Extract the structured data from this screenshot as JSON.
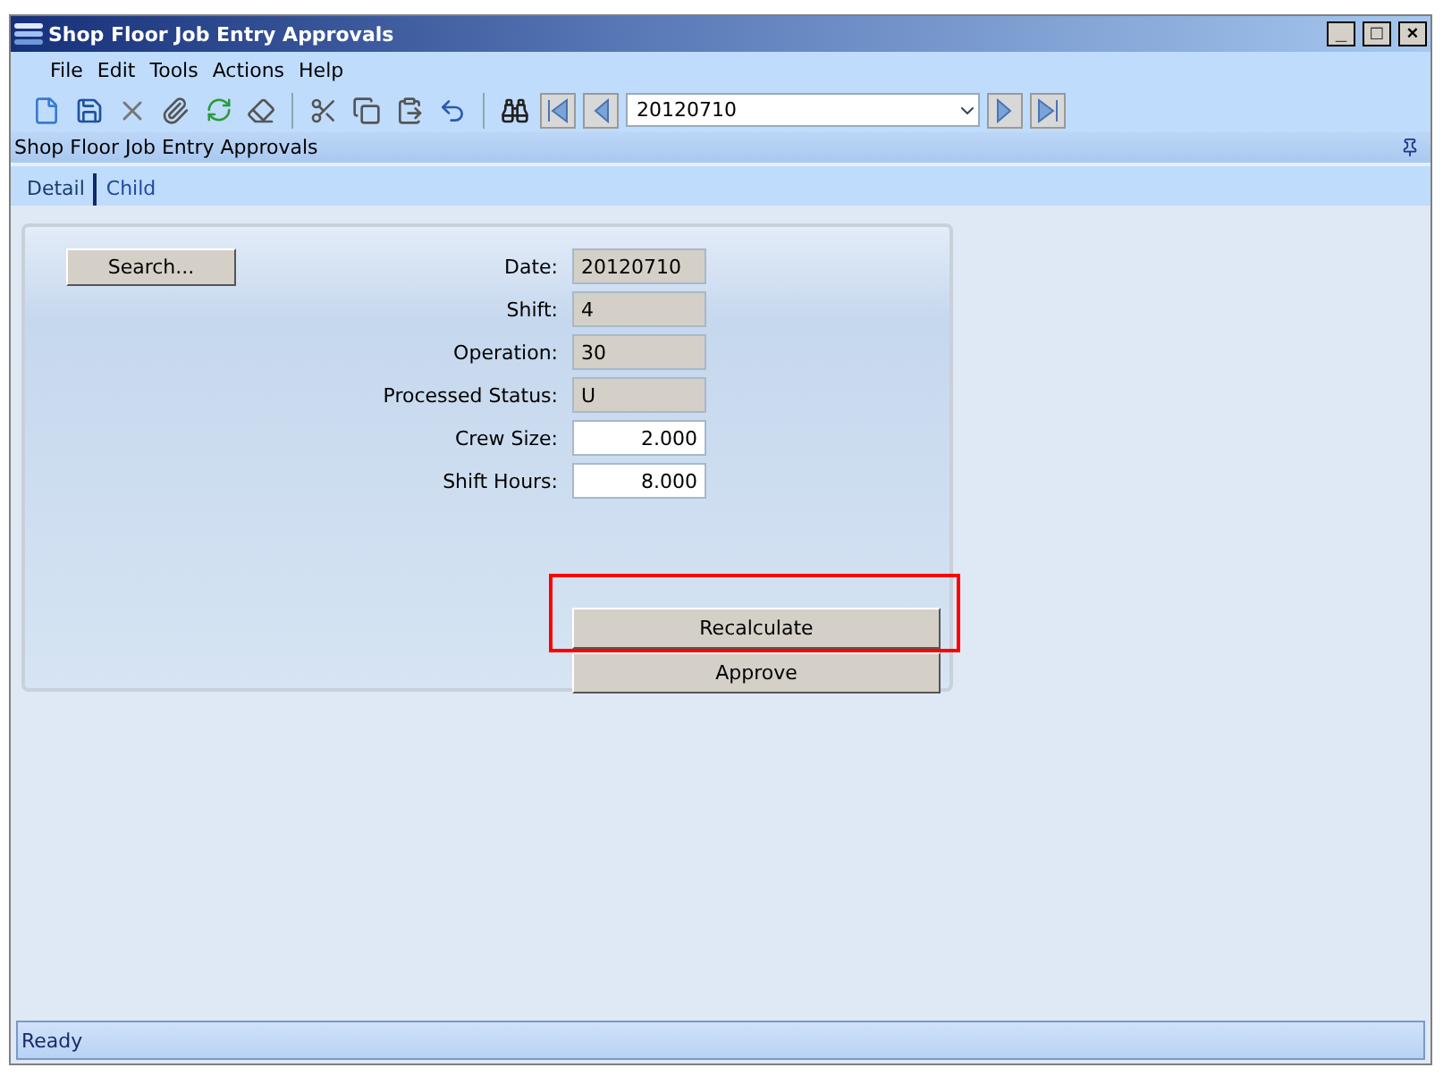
{
  "window": {
    "title": "Shop Floor Job Entry Approvals",
    "controls": [
      "_",
      "□",
      "×"
    ]
  },
  "menu": [
    "File",
    "Edit",
    "Tools",
    "Actions",
    "Help"
  ],
  "toolbar": {
    "record": "20120710"
  },
  "panel": {
    "title": "Shop Floor Job Entry Approvals"
  },
  "tabs": [
    {
      "label": "Detail",
      "selected": true
    },
    {
      "label": "Child",
      "selected": false
    }
  ],
  "search_button": "Search...",
  "fields": [
    {
      "label": "Date:",
      "value": "20120710",
      "kind": "readonly"
    },
    {
      "label": "Shift:",
      "value": "4",
      "kind": "readonly"
    },
    {
      "label": "Operation:",
      "value": "30",
      "kind": "readonly"
    },
    {
      "label": "Processed Status:",
      "value": "U",
      "kind": "readonly"
    },
    {
      "label": "Crew Size:",
      "value": "2.000",
      "kind": "editable"
    },
    {
      "label": "Shift Hours:",
      "value": "8.000",
      "kind": "editable"
    }
  ],
  "buttons": [
    {
      "label": "Recalculate",
      "highlighted": true
    },
    {
      "label": "Approve",
      "highlighted": false
    }
  ],
  "status_bar": "Ready"
}
